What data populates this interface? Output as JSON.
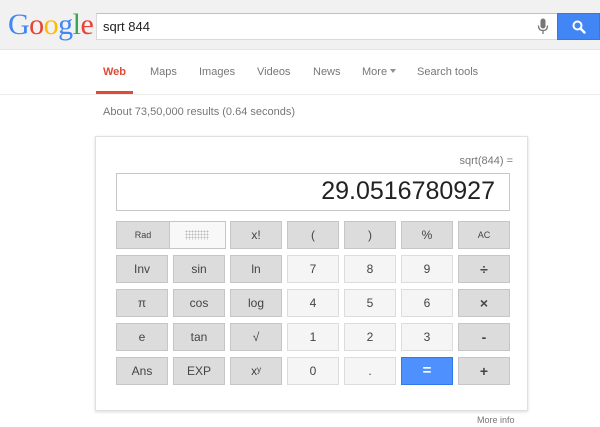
{
  "logo": {
    "letters": [
      "G",
      "o",
      "o",
      "g",
      "l",
      "e"
    ],
    "colors": [
      "#4285f4",
      "#ea4335",
      "#fbbc05",
      "#4285f4",
      "#34a853",
      "#ea4335"
    ]
  },
  "search": {
    "query": "sqrt 844"
  },
  "tabs": [
    {
      "label": "Web",
      "active": true
    },
    {
      "label": "Maps"
    },
    {
      "label": "Images"
    },
    {
      "label": "Videos"
    },
    {
      "label": "News"
    },
    {
      "label": "More"
    },
    {
      "label": "Search tools"
    }
  ],
  "stats": "About 73,50,000 results (0.64 seconds)",
  "calculator": {
    "expression": "sqrt(844) =",
    "result": "29.0516780927",
    "mode": {
      "rad": "Rad",
      "deg": "Deg"
    },
    "keys": [
      [
        "x!",
        "(",
        ")",
        "%",
        "AC"
      ],
      [
        "Inv",
        "sin",
        "ln",
        "7",
        "8",
        "9",
        "÷"
      ],
      [
        "π",
        "cos",
        "log",
        "4",
        "5",
        "6",
        "×"
      ],
      [
        "e",
        "tan",
        "√",
        "1",
        "2",
        "3",
        "-"
      ],
      [
        "Ans",
        "EXP",
        "xʸ",
        "0",
        ".",
        "=",
        "+"
      ]
    ]
  },
  "more_info": "More info"
}
